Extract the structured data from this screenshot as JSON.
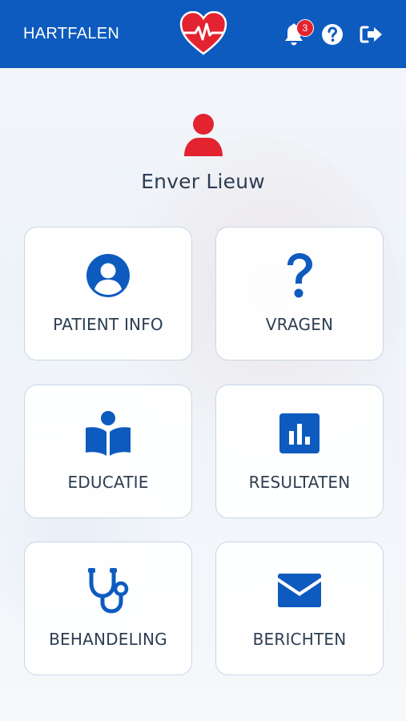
{
  "header": {
    "title": "HARTFALEN",
    "logo_icon": "heart-pulse-icon",
    "notification_count": "3",
    "icons": [
      "bell-icon",
      "help-icon",
      "logout-icon"
    ]
  },
  "colors": {
    "primary": "#0d5bbf",
    "accent_red": "#e3232f",
    "text": "#2d3e52",
    "tile_border": "#c7d6e8"
  },
  "profile": {
    "avatar_icon": "user-icon",
    "name": "Enver Lieuw"
  },
  "tiles": [
    {
      "label": "PATIENT INFO",
      "icon": "user-circle-icon"
    },
    {
      "label": "VRAGEN",
      "icon": "question-icon"
    },
    {
      "label": "EDUCATIE",
      "icon": "reader-book-icon"
    },
    {
      "label": "RESULTATEN",
      "icon": "bar-chart-icon"
    },
    {
      "label": "BEHANDELING",
      "icon": "stethoscope-icon"
    },
    {
      "label": "BERICHTEN",
      "icon": "envelope-icon"
    }
  ]
}
